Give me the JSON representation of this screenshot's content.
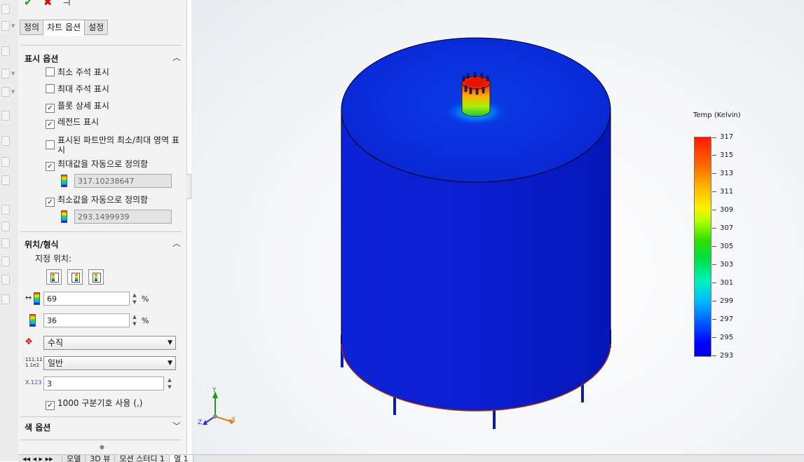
{
  "toolbar": {
    "ok_icon": "check-icon",
    "cancel_icon": "close-icon",
    "pin_icon": "pin-icon"
  },
  "tabs": [
    {
      "label": "정의",
      "active": false
    },
    {
      "label": "차트 옵션",
      "active": true
    },
    {
      "label": "설정",
      "active": false
    }
  ],
  "display_options": {
    "title": "표시 옵션",
    "checkboxes": [
      {
        "label": "최소 주석 표시",
        "checked": false
      },
      {
        "label": "최대 주석 표시",
        "checked": false
      },
      {
        "label": "플롯 상세 표시",
        "checked": true
      },
      {
        "label": "레전드 표시",
        "checked": true
      },
      {
        "label": "표시된 파트만의 최소/최대 영역 표시",
        "checked": false
      }
    ],
    "auto_max_label": "최대값을 자동으로 정의함",
    "auto_max_checked": true,
    "max_value": "317.10238647",
    "auto_min_label": "최소값을 자동으로 정의함",
    "auto_min_checked": true,
    "min_value": "293.1499939"
  },
  "position_format": {
    "title": "위치/형식",
    "predefined_label": "지정 위치:",
    "x_position": "69",
    "y_position": "36",
    "percent_unit": "%",
    "orientation": "수직",
    "number_format": "일반",
    "number_format_icon_text_top": "111.11",
    "number_format_icon_text_bottom": "1.1e2",
    "decimals_icon_text": "X.123",
    "decimals": "3",
    "thousands_separator_label": "1000 구분기호 사용 (,)",
    "thousands_separator_checked": true
  },
  "color_options": {
    "title": "색 옵션"
  },
  "bottom_tabs": [
    "모델",
    "3D 뷰",
    "모션 스터디 1",
    "열 1"
  ],
  "legend": {
    "title": "Temp (Kelvin)",
    "ticks": [
      "317",
      "315",
      "313",
      "311",
      "309",
      "307",
      "305",
      "303",
      "301",
      "299",
      "297",
      "295",
      "293"
    ]
  },
  "triad": {
    "x": "X",
    "y": "Y",
    "z": "Z"
  },
  "colors": {
    "max_color": "#ff1a00",
    "min_color": "#0000e6",
    "accent": "#1e9b1e"
  }
}
